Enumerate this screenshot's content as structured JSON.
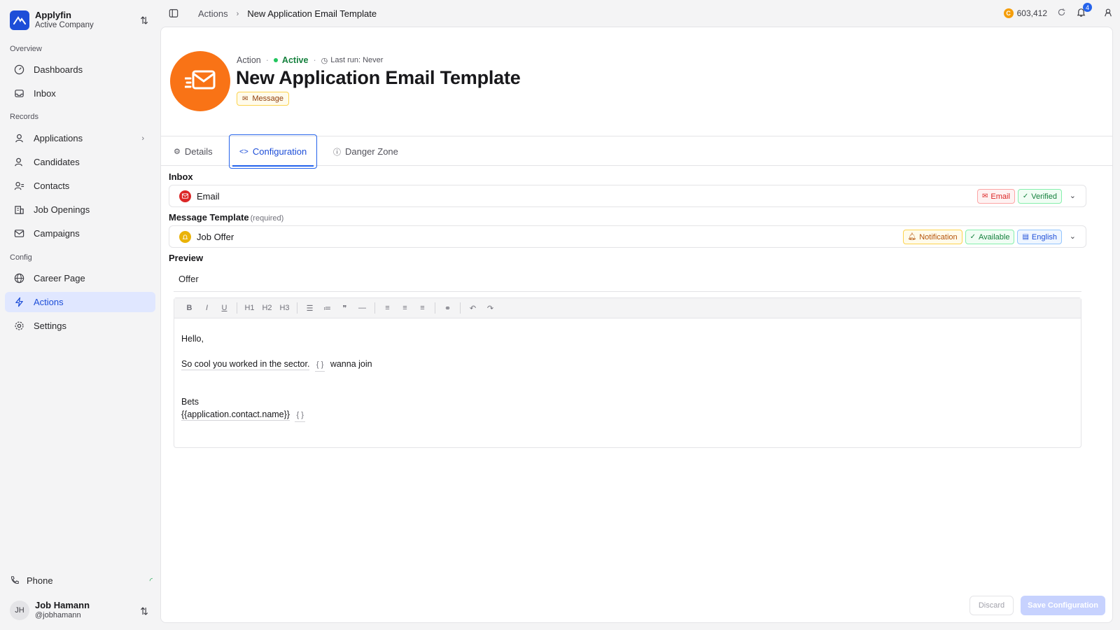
{
  "company": {
    "name": "Applyfin",
    "subtitle": "Active Company"
  },
  "sidebar": {
    "sections": [
      {
        "label": "Overview"
      },
      {
        "label": "Records"
      },
      {
        "label": "Config"
      }
    ],
    "items": [
      {
        "label": "Dashboards",
        "icon": "dashboard-icon"
      },
      {
        "label": "Inbox",
        "icon": "inbox-icon"
      },
      {
        "label": "Applications",
        "icon": "user-icon"
      },
      {
        "label": "Candidates",
        "icon": "candidate-icon"
      },
      {
        "label": "Contacts",
        "icon": "contacts-icon"
      },
      {
        "label": "Job Openings",
        "icon": "building-icon"
      },
      {
        "label": "Campaigns",
        "icon": "mail-check-icon"
      },
      {
        "label": "Career Page",
        "icon": "globe-icon"
      },
      {
        "label": "Actions",
        "icon": "bolt-icon",
        "active": true
      },
      {
        "label": "Settings",
        "icon": "gear-icon"
      }
    ],
    "phone_label": "Phone",
    "user": {
      "initials": "JH",
      "name": "Job Hamann",
      "handle": "@jobhamann"
    }
  },
  "topbar": {
    "breadcrumb": [
      "Actions",
      "New Application Email Template"
    ],
    "credits": "603,412",
    "credit_symbol": "C",
    "notifications": "4"
  },
  "header": {
    "kind": "Action",
    "status": "Active",
    "last_run": "Last run: Never",
    "title": "New Application Email Template",
    "type_badge": "Message",
    "accent": "#f97316"
  },
  "tabs": [
    {
      "label": "Details",
      "icon": "gear-icon"
    },
    {
      "label": "Configuration",
      "icon": "code-icon",
      "active": true
    },
    {
      "label": "Danger Zone",
      "icon": "alert-icon"
    }
  ],
  "form": {
    "inbox": {
      "label": "Inbox",
      "value": "Email",
      "chips": [
        "Email",
        "Verified"
      ]
    },
    "template": {
      "label": "Message Template",
      "required": "(required)",
      "value": "Job Offer",
      "chips": [
        "Notification",
        "Available",
        "English"
      ]
    },
    "preview": {
      "label": "Preview",
      "subject": "Offer",
      "toolbar": [
        "B",
        "I",
        "U",
        "H1",
        "H2",
        "H3"
      ],
      "body": {
        "greeting": "Hello,",
        "line2_a": "So cool you worked in the sector.",
        "line2_var": "{ }",
        "line2_b": "wanna join",
        "signoff": "Bets",
        "signature": "{{application.contact.name}}",
        "signature_var": "{ }"
      }
    }
  },
  "buttons": {
    "discard": "Discard",
    "save": "Save Configuration"
  }
}
